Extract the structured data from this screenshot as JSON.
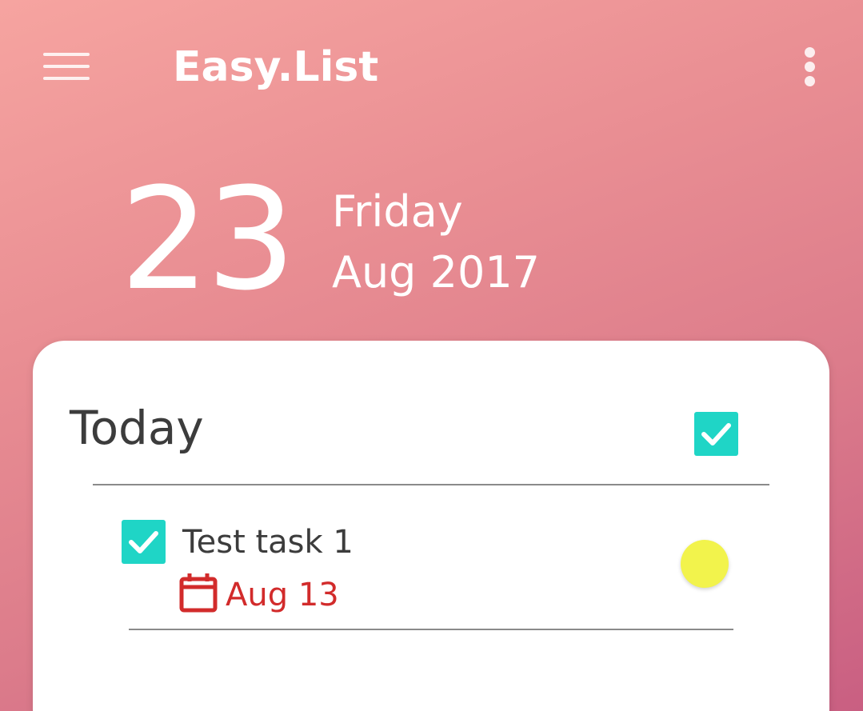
{
  "toolbar": {
    "title": "Easy.List",
    "menu_icon": "menu-icon",
    "overflow_icon": "more-vert-icon"
  },
  "date_header": {
    "day": "23",
    "weekday": "Friday",
    "month_year": "Aug 2017"
  },
  "sections": [
    {
      "title": "Today",
      "checked": true,
      "tasks": [
        {
          "title": "Test task 1",
          "checked": true,
          "due_date": "Aug 13",
          "due_icon": "calendar-icon",
          "priority_indicator": "priority-dot"
        }
      ]
    }
  ],
  "colors": {
    "accent": "#1fd5c6",
    "overdue": "#d22b2b",
    "priority": "#f2f34c",
    "text": "#3c3c3c",
    "background_start": "#f6a4a0",
    "background_end": "#c95f82"
  }
}
